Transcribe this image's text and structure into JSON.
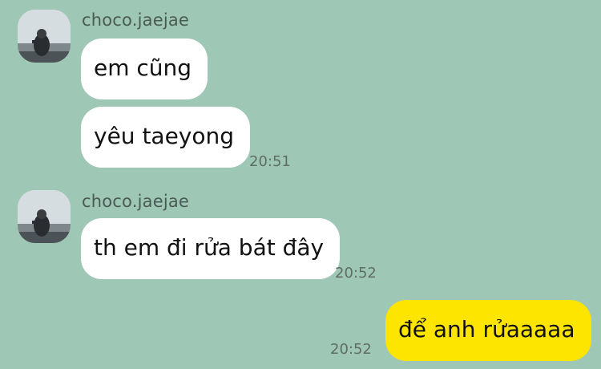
{
  "groups": [
    {
      "sender": "choco.jaejae",
      "messages": [
        {
          "text": "em cũng"
        },
        {
          "text": "yêu taeyong",
          "time": "20:51"
        }
      ]
    },
    {
      "sender": "choco.jaejae",
      "messages": [
        {
          "text": "th em đi rửa bát đây",
          "time": "20:52"
        }
      ]
    }
  ],
  "outgoing": [
    {
      "text": "để anh rửaaaaa",
      "time": "20:52"
    }
  ],
  "colors": {
    "background": "#9fc7b5",
    "incoming_bubble": "#ffffff",
    "outgoing_bubble": "#fde500"
  }
}
